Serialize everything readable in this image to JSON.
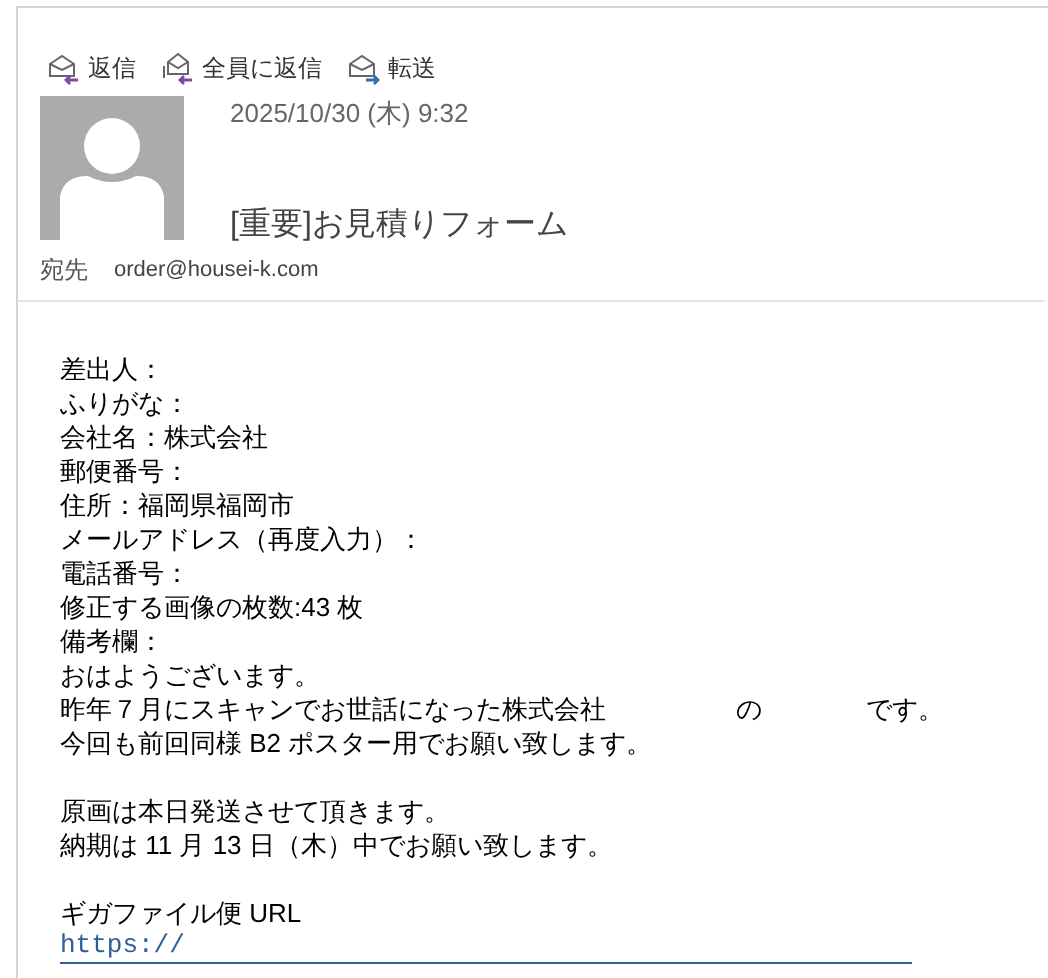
{
  "toolbar": [
    {
      "kind": "reply",
      "label": "返信"
    },
    {
      "kind": "reply_all",
      "label": "全員に返信"
    },
    {
      "kind": "forward",
      "label": "転送"
    }
  ],
  "message": {
    "date": "2025/10/30 (木) 9:32",
    "subject": "[重要]お見積りフォーム",
    "to_label": "宛先",
    "to": "order@housei-k.com"
  },
  "body": [
    [
      "差出人：",
      "ふりがな：",
      "会社名：株式会社",
      "郵便番号：",
      "住所：福岡県福岡市",
      "メールアドレス（再度入力）：",
      "電話番号：",
      "修正する画像の枚数:43 枚",
      "備考欄：",
      "おはようございます。",
      "昨年７月にスキャンでお世話になった株式会社　　　　　の　　　　です。",
      "今回も前回同様 B2 ポスター用でお願い致します。"
    ],
    [
      "原画は本日発送させて頂きます。",
      "納期は 11 月 13 日（木）中でお願い致します。"
    ],
    [
      "ギガファイル便 URL"
    ]
  ],
  "link": "https://"
}
